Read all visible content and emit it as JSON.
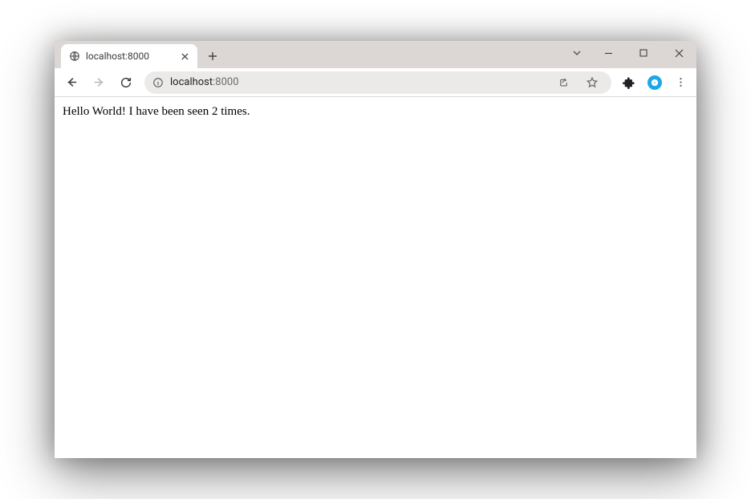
{
  "window": {
    "tab_title": "localhost:8000"
  },
  "address": {
    "host": "localhost",
    "port": ":8000"
  },
  "page": {
    "body_text": "Hello World! I have been seen 2 times."
  }
}
